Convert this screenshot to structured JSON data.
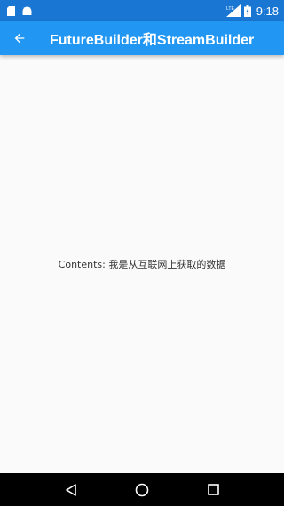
{
  "status_bar": {
    "time": "9:18",
    "network_label": "LTE",
    "icons": [
      "sim-card-icon",
      "android-icon",
      "lte-signal-icon",
      "battery-icon"
    ]
  },
  "app_bar": {
    "title": "FutureBuilder和StreamBuilder",
    "back_icon": "arrow-back-icon",
    "background_color": "#2196f3",
    "status_color": "#1976d2"
  },
  "main": {
    "content_text": "Contents: 我是从互联网上获取的数据"
  },
  "nav_bar": {
    "icons": [
      "back-triangle-icon",
      "home-circle-icon",
      "recents-square-icon"
    ]
  }
}
